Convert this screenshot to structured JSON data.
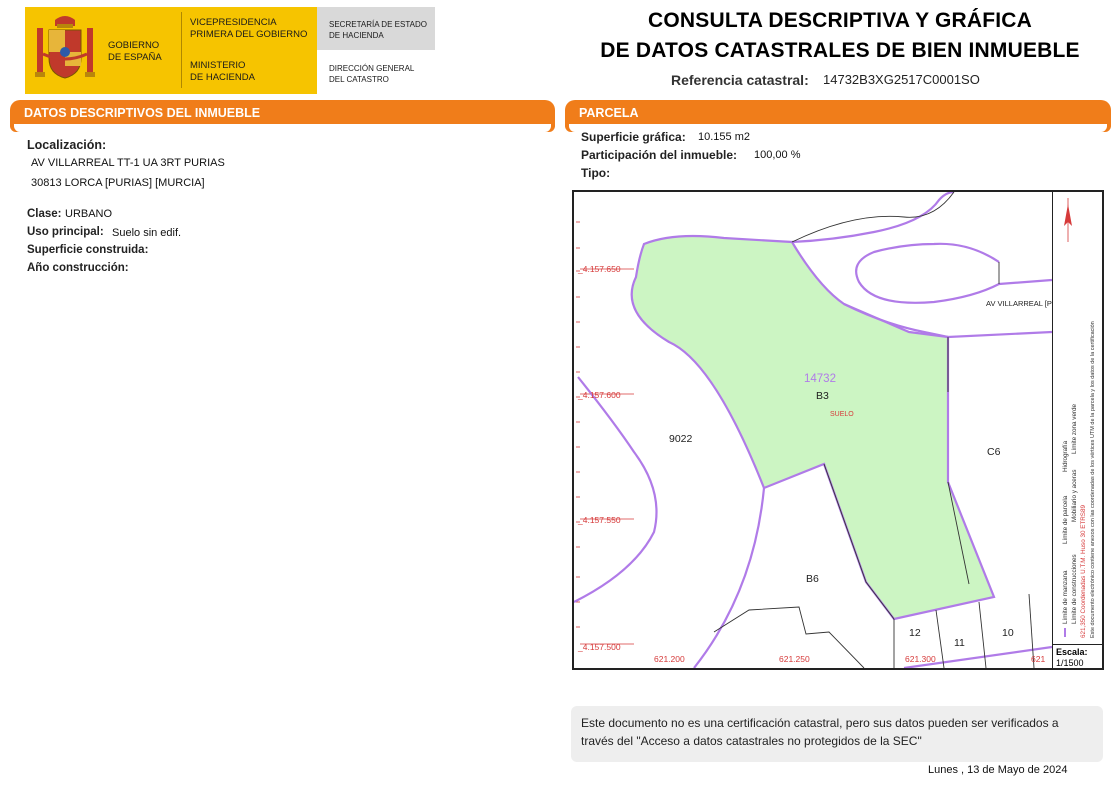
{
  "header": {
    "gob_line1": "GOBIERNO",
    "gob_line2": "DE ESPAÑA",
    "vice_line1": "VICEPRESIDENCIA",
    "vice_line2": "PRIMERA DEL GOBIERNO",
    "min_line1": "MINISTERIO",
    "min_line2": "DE HACIENDA",
    "sec_line1": "SECRETARÍA DE ESTADO",
    "sec_line2": "DE HACIENDA",
    "dir_line1": "DIRECCIÓN GENERAL",
    "dir_line2": "DEL CATASTRO",
    "title_line1": "CONSULTA DESCRIPTIVA Y GRÁFICA",
    "title_line2": "DE DATOS CATASTRALES DE BIEN INMUEBLE",
    "ref_label": "Referencia catastral:",
    "ref_value": "14732B3XG2517C0001SO"
  },
  "datos": {
    "section_title": "DATOS DESCRIPTIVOS DEL INMUEBLE",
    "localizacion_label": "Localización:",
    "address_line1": "AV VILLARREAL  TT-1 UA 3RT PURIAS",
    "address_line2": "30813 LORCA [PURIAS] [MURCIA]",
    "clase_label": "Clase:",
    "clase_value": "URBANO",
    "uso_label": "Uso principal:",
    "uso_value": "Suelo sin edif.",
    "sup_construida_label": "Superficie construida:",
    "anio_label": "Año construcción:"
  },
  "parcela": {
    "section_title": "PARCELA",
    "sup_grafica_label": "Superficie gráfica:",
    "sup_grafica_value": "10.155 m2",
    "participacion_label": "Participación del inmueble:",
    "participacion_value": "100,00 %",
    "tipo_label": "Tipo:"
  },
  "map": {
    "parcel_number": "14732",
    "parcel_code": "B3",
    "suelo_label": "SUELO",
    "street_label": "AV VILLARREAL [PU",
    "parcels": [
      "9022",
      "C6",
      "B6",
      "12",
      "11",
      "10"
    ],
    "y_ticks": [
      "4.157.650",
      "4.157.600",
      "4.157.550",
      "4.157.500"
    ],
    "x_ticks": [
      "621.200",
      "621.250",
      "621.300",
      "621"
    ],
    "legend": {
      "limite_manzana": "Límite de manzana",
      "limite_parcela": "Límite de parcela",
      "hidrografia": "Hidrografía",
      "limite_construcciones": "Límite de construcciones",
      "mobiliario": "Mobiliario y aceras",
      "limite_zona_verde": "Límite zona verde",
      "coords": "621,350 Coordenadas U.T.M. Huso 30 ETRS89",
      "nota": "Este documento electrónico contiene anexos con las coordenadas de los vértices UTM de la parcela y los datos de la certificación"
    },
    "scale_label": "Escala:",
    "scale_value": "1/1500",
    "colors": {
      "parcel_fill": "#ccf5c3",
      "manzana": "#b07be8",
      "grid_label": "#d63a3a"
    }
  },
  "footer": {
    "notice": "Este documento no es una certificación catastral, pero sus datos pueden ser verificados a través del \"Acceso a datos catastrales no protegidos de la SEC\"",
    "date": "Lunes , 13 de Mayo de 2024"
  }
}
